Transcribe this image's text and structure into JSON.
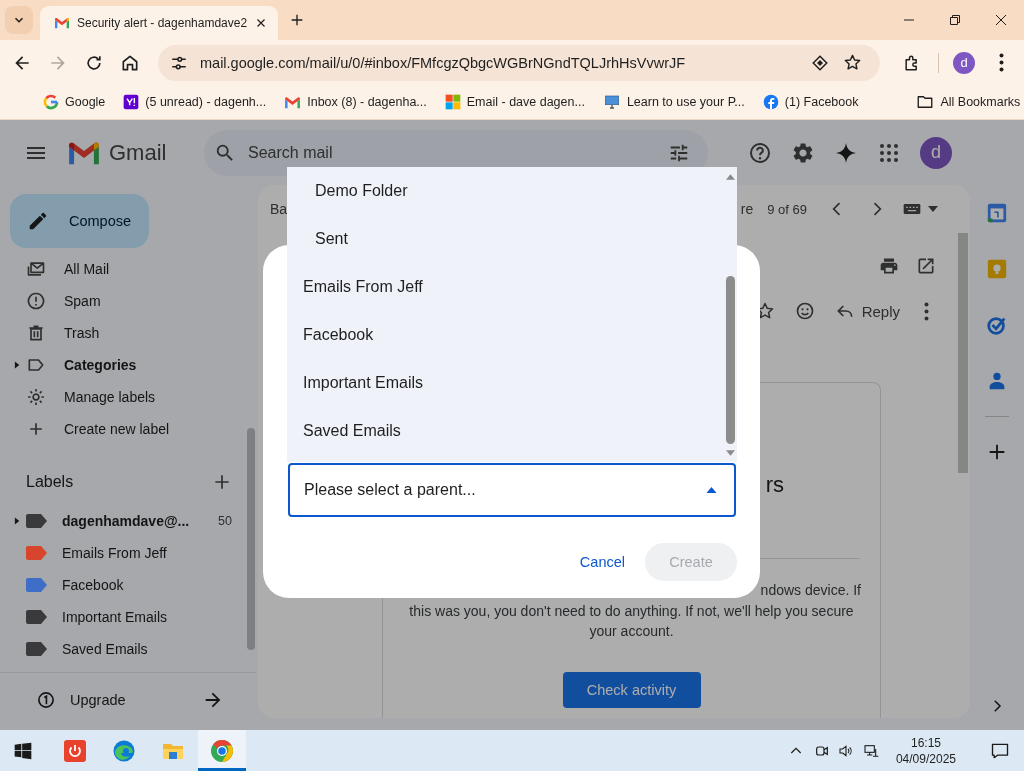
{
  "browser": {
    "tab": {
      "title": "Security alert - dagenhamdave2"
    },
    "url": "mail.google.com/mail/u/0/#inbox/FMfcgzQbgcWGBrNGndTQLJrhHsVvwrJF",
    "profile_initial": "d",
    "bookmarks": [
      {
        "kind": "google",
        "label": "Google"
      },
      {
        "kind": "yahoo",
        "label": "(5 unread) - dagenh..."
      },
      {
        "kind": "gmail",
        "label": "Inbox (8) - dagenha..."
      },
      {
        "kind": "microsoft",
        "label": "Email - dave dagen..."
      },
      {
        "kind": "monitor",
        "label": "Learn to use your P..."
      },
      {
        "kind": "facebook",
        "label": "(1) Facebook"
      }
    ],
    "all_bookmarks": "All Bookmarks"
  },
  "gmail": {
    "app_name": "Gmail",
    "search": {
      "placeholder": "Search mail"
    },
    "account_initial": "d",
    "compose": "Compose",
    "nav": [
      {
        "kind": "all-mail",
        "label": "All Mail",
        "unread": false,
        "expandable": false
      },
      {
        "kind": "spam",
        "label": "Spam",
        "unread": false,
        "expandable": false
      },
      {
        "kind": "trash",
        "label": "Trash",
        "unread": false,
        "expandable": false
      },
      {
        "kind": "categories",
        "label": "Categories",
        "unread": true,
        "expandable": true
      },
      {
        "kind": "manage",
        "label": "Manage labels",
        "unread": false,
        "expandable": false
      },
      {
        "kind": "create",
        "label": "Create new label",
        "unread": false,
        "expandable": false
      }
    ],
    "labels_heading": "Labels",
    "labels": [
      {
        "label": "dagenhamdave@...",
        "count": "50",
        "color": "#3a3a3c",
        "unread": true,
        "expandable": true
      },
      {
        "label": "Emails From Jeff",
        "color": "#d6452c",
        "unread": false,
        "expandable": false
      },
      {
        "label": "Facebook",
        "color": "#3e6ec8",
        "unread": false,
        "expandable": false
      },
      {
        "label": "Important Emails",
        "color": "#3a3a3c",
        "unread": false,
        "expandable": false
      },
      {
        "label": "Saved Emails",
        "color": "#3a3a3c",
        "unread": false,
        "expandable": false
      }
    ],
    "upgrade": "Upgrade",
    "toolbar": {
      "left_fragment": "Ba",
      "right_fragment": "re",
      "position": "9 of 69"
    },
    "reply": "Reply",
    "message": {
      "heading_fragment": "rs",
      "line_fragment": "ndows device. If",
      "paragraph": "this was you, you don't need to do anything. If not, we'll help you secure your account.",
      "button": "Check activity"
    }
  },
  "dialog": {
    "parent_select": {
      "text": "Please select a parent...",
      "expanded": true
    },
    "options": [
      {
        "kind": "system",
        "label": "Demo Folder",
        "selected": false
      },
      {
        "kind": "system",
        "label": "Sent",
        "selected": false
      },
      {
        "kind": "user",
        "label": "Emails From Jeff",
        "selected": false
      },
      {
        "kind": "user",
        "label": "Facebook",
        "selected": false
      },
      {
        "kind": "user",
        "label": "Important Emails",
        "selected": false
      },
      {
        "kind": "user",
        "label": "Saved Emails",
        "selected": false
      }
    ],
    "buttons": [
      {
        "kind": "text",
        "label": "Cancel",
        "disabled": false
      },
      {
        "kind": "filled",
        "label": "Create",
        "disabled": true
      }
    ]
  },
  "taskbar": {
    "apps": [
      {
        "kind": "power",
        "selected": false
      },
      {
        "kind": "edge",
        "selected": false
      },
      {
        "kind": "explorer",
        "selected": false
      },
      {
        "kind": "chrome",
        "selected": true
      }
    ],
    "time": "16:15",
    "date": "04/09/2025"
  }
}
